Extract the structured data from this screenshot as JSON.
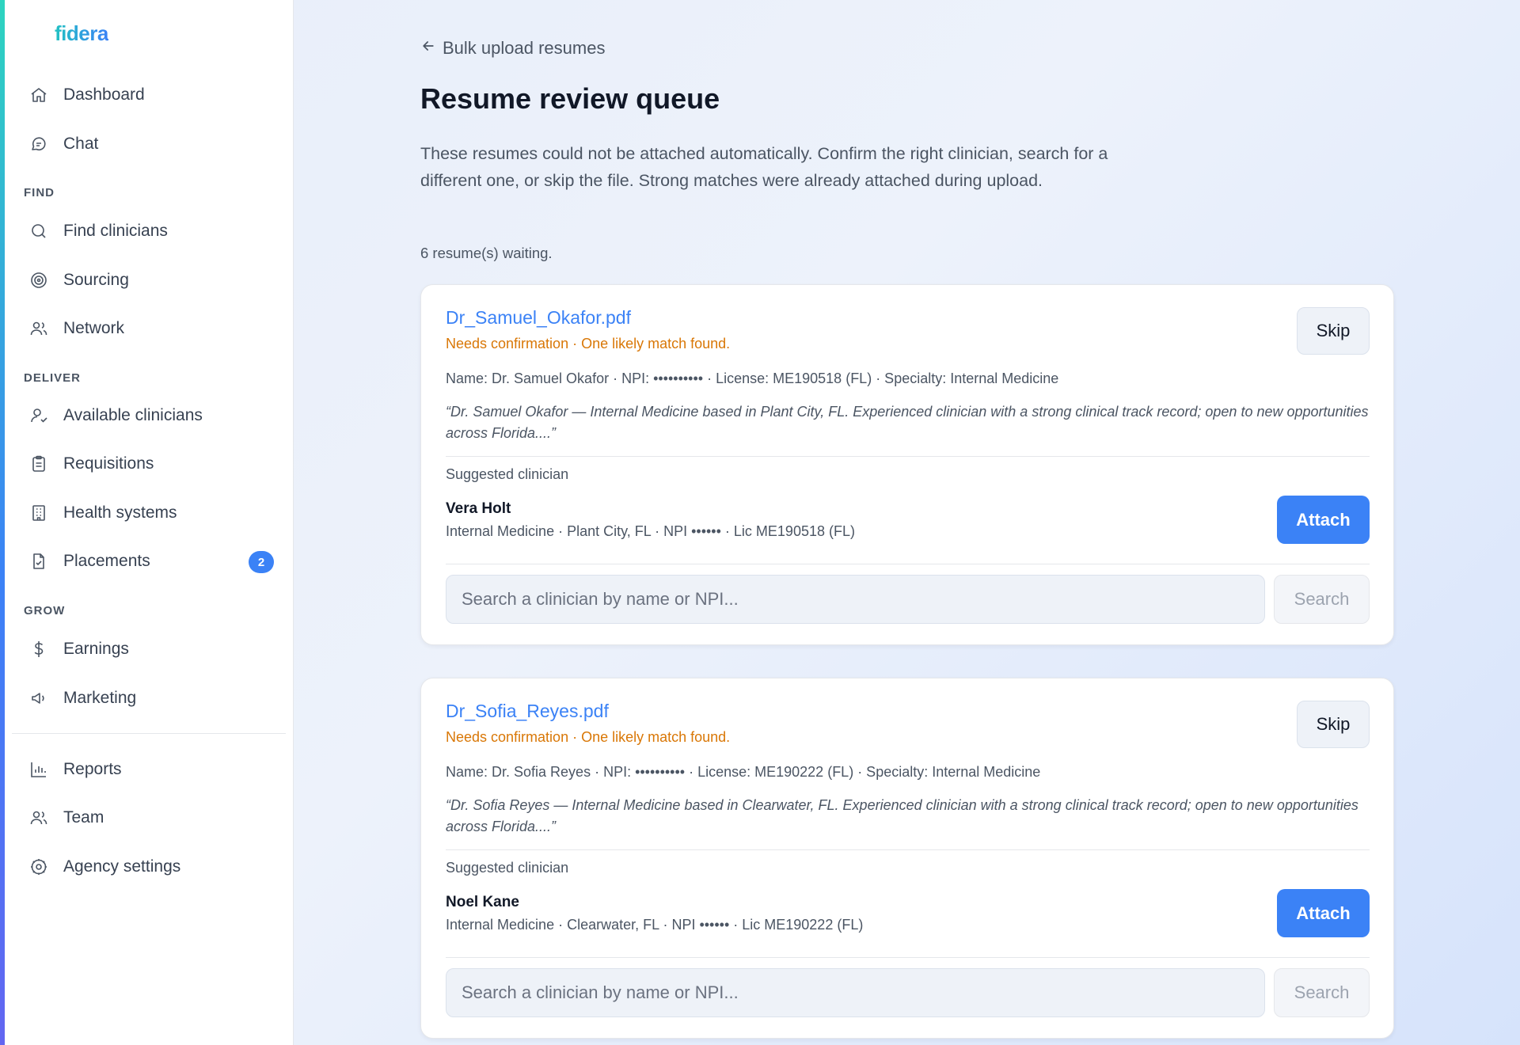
{
  "app": {
    "logo": "fidera"
  },
  "sidebar": {
    "top_items": [
      {
        "label": "Dashboard",
        "icon": "home-icon"
      },
      {
        "label": "Chat",
        "icon": "chat-icon"
      }
    ],
    "sections": {
      "find": "FIND",
      "deliver": "DELIVER",
      "grow": "GROW"
    },
    "find_items": [
      {
        "label": "Find clinicians",
        "icon": "search-icon"
      },
      {
        "label": "Sourcing",
        "icon": "target-icon"
      },
      {
        "label": "Network",
        "icon": "users-icon"
      }
    ],
    "deliver_items": [
      {
        "label": "Available clinicians",
        "icon": "user-check-icon"
      },
      {
        "label": "Requisitions",
        "icon": "clipboard-icon"
      },
      {
        "label": "Health systems",
        "icon": "building-icon"
      },
      {
        "label": "Placements",
        "icon": "file-check-icon",
        "badge": "2"
      }
    ],
    "grow_items": [
      {
        "label": "Earnings",
        "icon": "dollar-icon"
      },
      {
        "label": "Marketing",
        "icon": "megaphone-icon"
      }
    ],
    "bottom_items": [
      {
        "label": "Reports",
        "icon": "bar-chart-icon"
      },
      {
        "label": "Team",
        "icon": "team-icon"
      },
      {
        "label": "Agency settings",
        "icon": "gear-icon"
      }
    ]
  },
  "header": {
    "back_link": "Bulk upload resumes",
    "title": "Resume review queue",
    "description": "These resumes could not be attached automatically. Confirm the right clinician, search for a different one, or skip the file. Strong matches were already attached during upload.",
    "waiting": "6 resume(s) waiting."
  },
  "cards": [
    {
      "filename": "Dr_Samuel_Okafor.pdf",
      "status": "Needs confirmation · One likely match found.",
      "meta": "Name: Dr. Samuel Okafor · NPI: •••••••••• · License: ME190518 (FL) · Specialty: Internal Medicine",
      "quote": "“Dr. Samuel Okafor — Internal Medicine based in Plant City, FL. Experienced clinician with a strong clinical track record; open to new opportunities across Florida....”",
      "suggested_label": "Suggested clinician",
      "clinician_name": "Vera Holt",
      "clinician_detail": "Internal Medicine · Plant City, FL · NPI •••••• · Lic ME190518 (FL)",
      "skip_label": "Skip",
      "attach_label": "Attach",
      "search_placeholder": "Search a clinician by name or NPI...",
      "search_label": "Search"
    },
    {
      "filename": "Dr_Sofia_Reyes.pdf",
      "status": "Needs confirmation · One likely match found.",
      "meta": "Name: Dr. Sofia Reyes · NPI: •••••••••• · License: ME190222 (FL) · Specialty: Internal Medicine",
      "quote": "“Dr. Sofia Reyes — Internal Medicine based in Clearwater, FL. Experienced clinician with a strong clinical track record; open to new opportunities across Florida....”",
      "suggested_label": "Suggested clinician",
      "clinician_name": "Noel Kane",
      "clinician_detail": "Internal Medicine · Clearwater, FL · NPI •••••• · Lic ME190222 (FL)",
      "skip_label": "Skip",
      "attach_label": "Attach",
      "search_placeholder": "Search a clinician by name or NPI...",
      "search_label": "Search"
    }
  ],
  "colors": {
    "accent": "#3b82f6",
    "warning": "#d97706"
  }
}
